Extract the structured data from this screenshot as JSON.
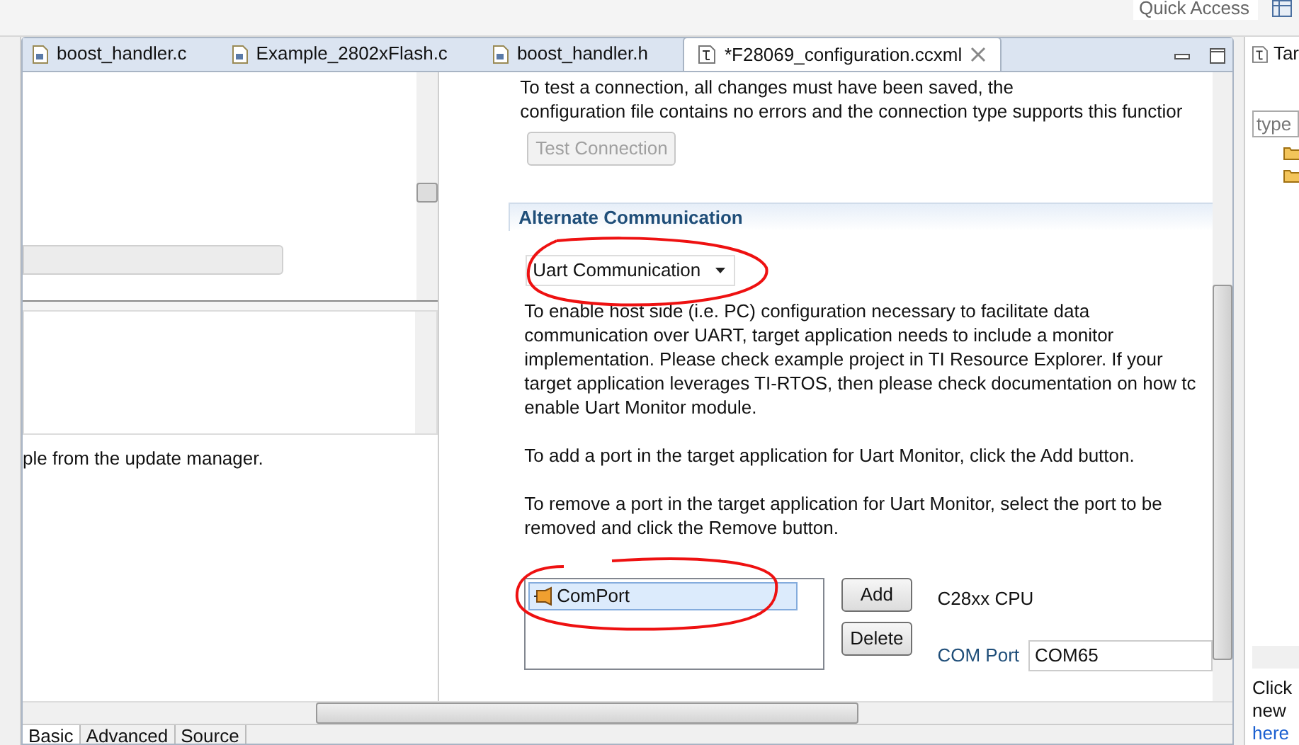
{
  "toolbar": {
    "quick_access": "Quick Access"
  },
  "editor_tabs": [
    {
      "label": "boost_handler.c",
      "kind": "c",
      "selected": false
    },
    {
      "label": "Example_2802xFlash.c",
      "kind": "c",
      "selected": false
    },
    {
      "label": "boost_handler.h",
      "kind": "h",
      "selected": false
    },
    {
      "label": "*F28069_configuration.ccxml",
      "kind": "ccxml",
      "selected": true
    }
  ],
  "left_pane": {
    "message": "ple from the update manager."
  },
  "test_connection": {
    "lines": [
      "To test a connection, all changes must have been saved, the",
      "configuration file contains no errors and the connection type supports this functior"
    ],
    "button": "Test Connection",
    "disabled": true
  },
  "alternate_communication": {
    "title": "Alternate Communication",
    "dropdown": "Uart Communication",
    "paragraphs": [
      [
        "To enable host side (i.e. PC) configuration necessary to facilitate data",
        "communication over UART, target application needs to include a monitor",
        "implementation. Please check example project in TI Resource Explorer. If your",
        "target application leverages TI-RTOS, then please check documentation on how tc",
        "enable Uart Monitor module."
      ],
      [
        "To add a port in the target application for Uart Monitor, click the Add button."
      ],
      [
        "To remove a port in the target application for Uart Monitor, select the port to be",
        "removed and click the Remove button."
      ]
    ]
  },
  "ports": {
    "items": [
      {
        "label": "ComPort",
        "selected": true
      }
    ],
    "buttons": [
      "Add",
      "Delete"
    ],
    "cpu": "C28xx CPU",
    "com_port_label": "COM Port",
    "com_port_value": "COM65"
  },
  "bottom_tabs": [
    {
      "label": "Basic",
      "selected": true
    },
    {
      "label": "Advanced",
      "selected": false
    },
    {
      "label": "Source",
      "selected": false
    }
  ],
  "right_view": {
    "tab": "Tar",
    "filter_placeholder": "type",
    "hint_lines": [
      "Click",
      "new"
    ],
    "link": "here"
  }
}
